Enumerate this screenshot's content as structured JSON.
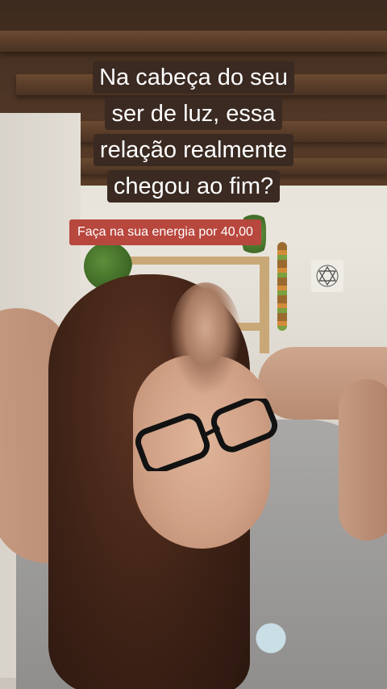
{
  "overlay": {
    "headline_lines": [
      "Na cabeça do seu",
      "ser de luz, essa",
      "relação realmente",
      "chegou ao fim?"
    ],
    "promo_label": "Faça na sua energia por 40,00"
  },
  "colors": {
    "headline_bg": "#3a2a22",
    "promo_bg": "#b8473e",
    "text": "#ffffff"
  },
  "icons": {
    "wall_decor": "star-of-david-icon"
  }
}
